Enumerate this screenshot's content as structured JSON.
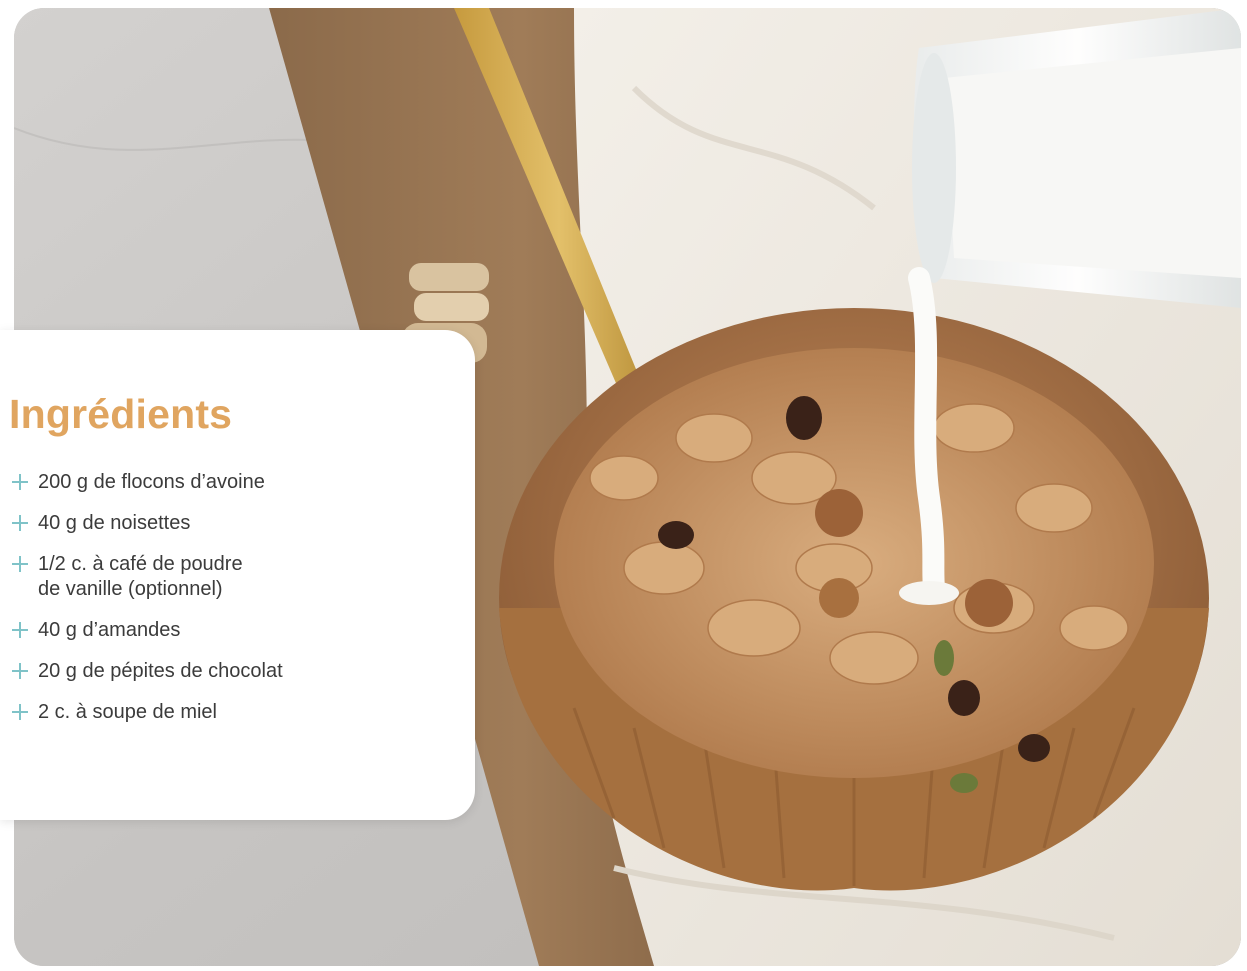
{
  "card": {
    "title": "Ingrédients",
    "items": [
      {
        "icon": "plus-icon",
        "text": "200 g de flocons d’avoine"
      },
      {
        "icon": "plus-icon",
        "text": "40 g de noisettes"
      },
      {
        "icon": "plus-icon",
        "text": "1/2 c. à café de poudre\nde vanille (optionnel)"
      },
      {
        "icon": "plus-icon",
        "text": "40 g d’amandes"
      },
      {
        "icon": "plus-icon",
        "text": "20 g de pépites de chocolat"
      },
      {
        "icon": "plus-icon",
        "text": "2 c. à soupe de miel"
      }
    ]
  },
  "colors": {
    "title": "#e0a560",
    "accent": "#7fc3c8",
    "text": "#3b3b3b",
    "card_bg": "#ffffff"
  },
  "photo": {
    "subject": "muesli-bowl-with-milk-pour"
  }
}
